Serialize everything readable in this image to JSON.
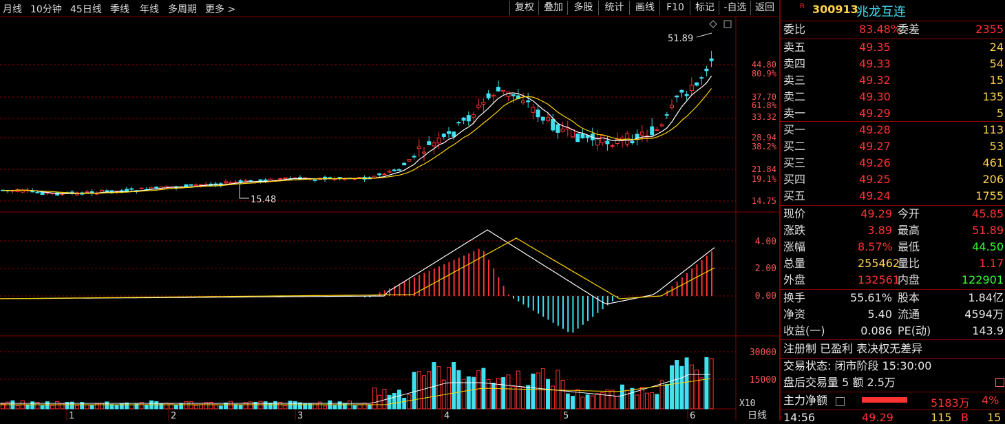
{
  "toolbar": {
    "periods": [
      "月线",
      "10分钟",
      "45日线",
      "季线",
      "年线",
      "多周期",
      "更多"
    ],
    "more_arrow": ">",
    "buttons": [
      "复权",
      "叠加",
      "多股",
      "统计",
      "画线",
      "F10",
      "标记",
      "-自选",
      "返回"
    ]
  },
  "stock": {
    "badge": "R",
    "code": "300913",
    "name": "兆龙互连"
  },
  "orderbook": {
    "weibi_label": "委比",
    "weibi_value": "83.48%",
    "weicha_label": "委差",
    "weicha_value": "2355",
    "asks": [
      {
        "label": "卖五",
        "price": "49.35",
        "vol": "24"
      },
      {
        "label": "卖四",
        "price": "49.33",
        "vol": "54"
      },
      {
        "label": "卖三",
        "price": "49.32",
        "vol": "15"
      },
      {
        "label": "卖二",
        "price": "49.30",
        "vol": "135"
      },
      {
        "label": "卖一",
        "price": "49.29",
        "vol": "5"
      }
    ],
    "bids": [
      {
        "label": "买一",
        "price": "49.28",
        "vol": "113"
      },
      {
        "label": "买二",
        "price": "49.27",
        "vol": "53"
      },
      {
        "label": "买三",
        "price": "49.26",
        "vol": "461"
      },
      {
        "label": "买四",
        "price": "49.25",
        "vol": "206"
      },
      {
        "label": "买五",
        "price": "49.24",
        "vol": "1755"
      }
    ]
  },
  "quote": {
    "rows": [
      {
        "l1": "现价",
        "v1": "49.29",
        "c1": "red",
        "l2": "今开",
        "v2": "45.85",
        "c2": "red"
      },
      {
        "l1": "涨跌",
        "v1": "3.89",
        "c1": "red",
        "l2": "最高",
        "v2": "51.89",
        "c2": "red"
      },
      {
        "l1": "涨幅",
        "v1": "8.57%",
        "c1": "red",
        "l2": "最低",
        "v2": "44.50",
        "c2": "grn"
      },
      {
        "l1": "总量",
        "v1": "255462",
        "c1": "yel",
        "l2": "量比",
        "v2": "1.17",
        "c2": "red"
      },
      {
        "l1": "外盘",
        "v1": "132561",
        "c1": "red",
        "l2": "内盘",
        "v2": "122901",
        "c2": "grn"
      }
    ],
    "rows2": [
      {
        "l1": "换手",
        "v1": "55.61%",
        "l2": "股本",
        "v2": "1.84亿"
      },
      {
        "l1": "净资",
        "v1": "5.40",
        "l2": "流通",
        "v2": "4594万"
      },
      {
        "l1": "收益(一)",
        "v1": "0.086",
        "l2": "PE(动)",
        "v2": "143.9"
      }
    ],
    "status_line": "注册制 已盈利 表决权无差异",
    "trade_state": "交易状态: 闭市阶段 15:30:00",
    "after_hours": "盘后交易量 5 额 2.5万",
    "main_flow_label": "主力净额",
    "main_flow_value": "5183万",
    "main_flow_pct": "4%",
    "last_tick": {
      "time": "14:56",
      "price": "49.29",
      "vol": "115",
      "side": "B",
      "num": "15"
    }
  },
  "chart_labels": {
    "price_axis": [
      "44.80",
      "80.9%",
      "37.70",
      "61.8%",
      "33.32",
      "28.94",
      "38.2%",
      "21.84",
      "19.1%",
      "14.75"
    ],
    "high_label": "51.89",
    "low_label": "15.48",
    "macd_axis": [
      "4.00",
      "2.00",
      "0.00"
    ],
    "vol_axis": [
      "30000",
      "15000"
    ],
    "vol_unit": "X10",
    "months": [
      "1",
      "2",
      "3",
      "4",
      "5",
      "6"
    ],
    "period_label": "日线"
  },
  "colors": {
    "up": "#ff3333",
    "down": "#40e0f0",
    "ma1": "#ffffff",
    "ma2": "#ffd700",
    "grid": "#8a0000"
  }
}
